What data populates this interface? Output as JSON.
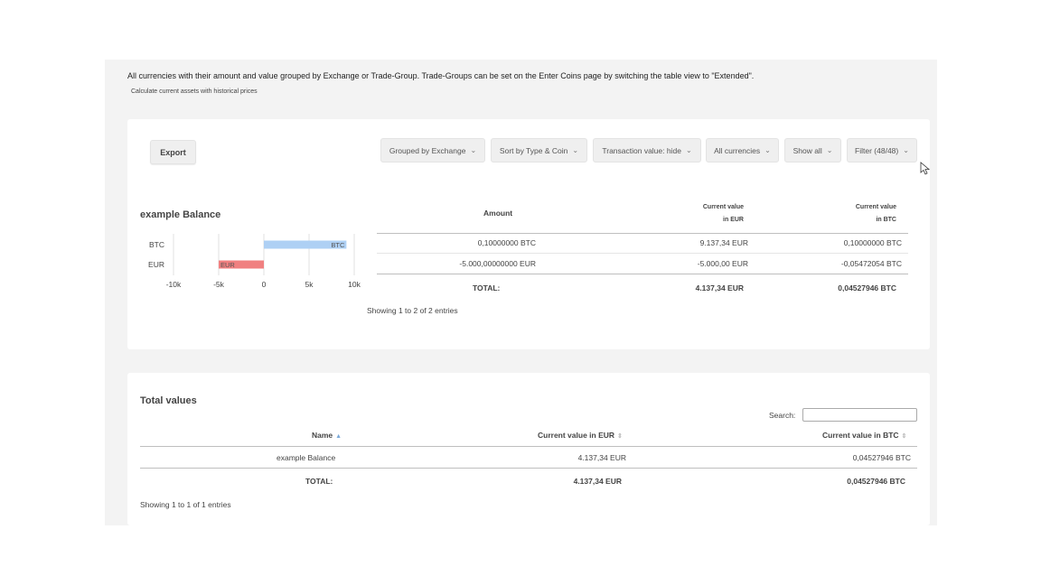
{
  "intro": "All currencies with their amount and value grouped by Exchange or Trade-Group. Trade-Groups can be set on the Enter Coins page by switching the table view to \"Extended\".",
  "subintro": "Calculate current assets with historical prices",
  "toolbar": {
    "export_label": "Export",
    "dropdowns": [
      {
        "label": "Grouped by Exchange"
      },
      {
        "label": "Sort by Type & Coin"
      },
      {
        "label": "Transaction value: hide"
      },
      {
        "label": "All currencies"
      },
      {
        "label": "Show all"
      },
      {
        "label": "Filter (48/48)"
      }
    ]
  },
  "balance": {
    "title": "example Balance",
    "headers": {
      "amount": "Amount",
      "value_eur_line1": "Current value",
      "value_eur_line2": "in EUR",
      "value_btc_line1": "Current value",
      "value_btc_line2": "in BTC"
    },
    "rows": [
      {
        "amount": "0,10000000 BTC",
        "eur": "9.137,34 EUR",
        "btc": "0,10000000 BTC"
      },
      {
        "amount": "-5.000,00000000 EUR",
        "eur": "-5.000,00 EUR",
        "btc": "-0,05472054 BTC"
      }
    ],
    "total": {
      "label": "TOTAL:",
      "eur": "4.137,34 EUR",
      "btc": "0,04527946 BTC"
    },
    "showing": "Showing 1 to 2 of 2 entries"
  },
  "chart_data": {
    "type": "bar",
    "orientation": "horizontal",
    "categories": [
      "BTC",
      "EUR"
    ],
    "values": [
      9137.34,
      -5000
    ],
    "data_labels": [
      "BTC",
      "EUR"
    ],
    "colors": [
      "#aed0f4",
      "#f08080"
    ],
    "xlim": [
      -10000,
      10000
    ],
    "xticks": [
      "-10k",
      "-5k",
      "0",
      "5k",
      "10k"
    ],
    "grid": true
  },
  "totals": {
    "title": "Total values",
    "search_label": "Search:",
    "search_value": "",
    "headers": {
      "name": "Name",
      "eur": "Current value in EUR",
      "btc": "Current value in BTC"
    },
    "rows": [
      {
        "name": "example Balance",
        "eur": "4.137,34 EUR",
        "btc": "0,04527946 BTC"
      }
    ],
    "total": {
      "label": "TOTAL:",
      "eur": "4.137,34 EUR",
      "btc": "0,04527946 BTC"
    },
    "showing": "Showing 1 to 1 of 1 entries"
  }
}
